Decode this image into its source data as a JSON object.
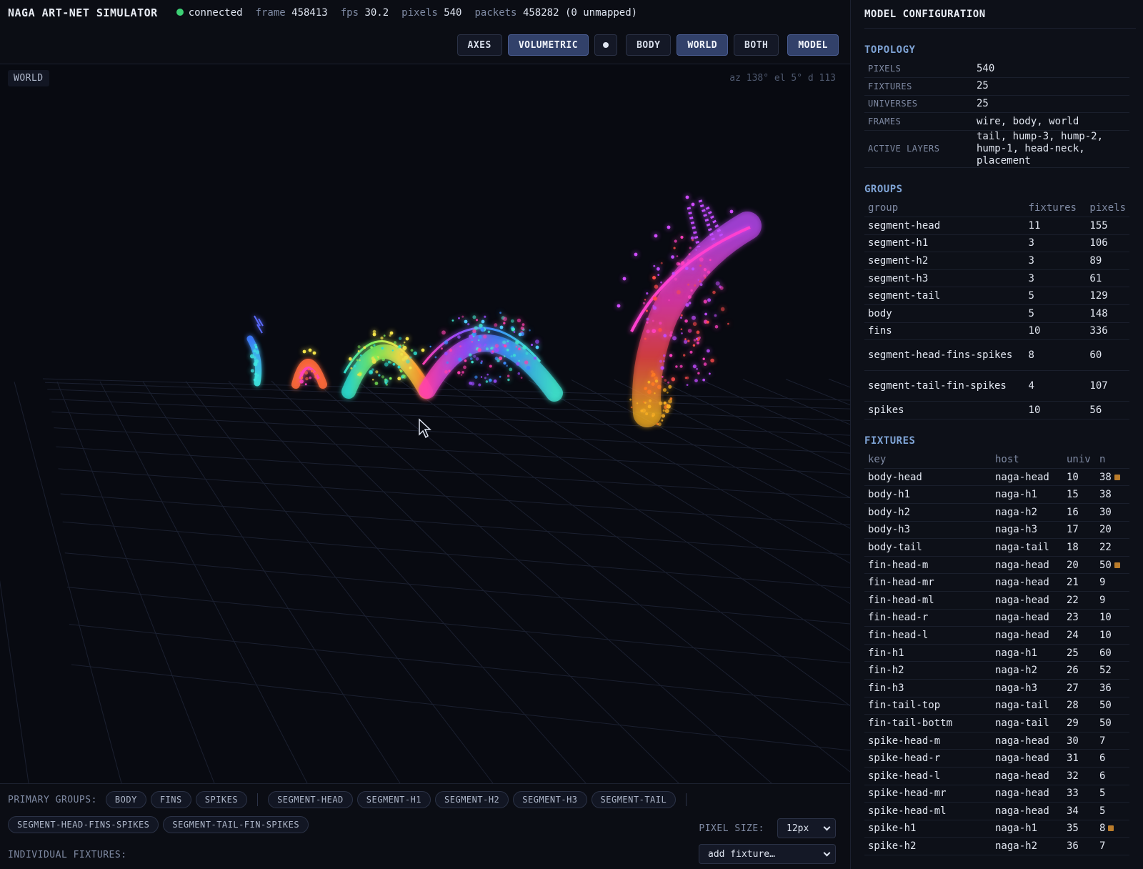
{
  "app": {
    "title": "NAGA ART-NET SIMULATOR",
    "status": "connected",
    "stats": [
      {
        "label": "frame",
        "value": "458413"
      },
      {
        "label": "fps",
        "value": "30.2"
      },
      {
        "label": "pixels",
        "value": "540"
      },
      {
        "label": "packets",
        "value": "458282 (0 unmapped)"
      }
    ]
  },
  "toolbar": {
    "axes": "AXES",
    "volumetric": "VOLUMETRIC",
    "body": "BODY",
    "world": "WORLD",
    "both": "BOTH",
    "model": "MODEL"
  },
  "viewport": {
    "label": "WORLD",
    "camera": "az 138° el 5° d 113"
  },
  "bottom": {
    "primary_label": "PRIMARY GROUPS:",
    "primary_groups": [
      "BODY",
      "FINS",
      "SPIKES"
    ],
    "segment_groups": [
      "SEGMENT-HEAD",
      "SEGMENT-H1",
      "SEGMENT-H2",
      "SEGMENT-H3",
      "SEGMENT-TAIL"
    ],
    "extra_groups": [
      "SEGMENT-HEAD-FINS-SPIKES",
      "SEGMENT-TAIL-FIN-SPIKES"
    ],
    "pixel_size_label": "PIXEL SIZE:",
    "pixel_size_value": "12px",
    "individual_label": "INDIVIDUAL FIXTURES:",
    "add_fixture": "add fixture…"
  },
  "panel": {
    "title": "MODEL CONFIGURATION",
    "topology": {
      "title": "TOPOLOGY",
      "rows": [
        {
          "k": "PIXELS",
          "v": "540"
        },
        {
          "k": "FIXTURES",
          "v": "25"
        },
        {
          "k": "UNIVERSES",
          "v": "25"
        },
        {
          "k": "FRAMES",
          "v": "wire, body, world"
        },
        {
          "k": "ACTIVE LAYERS",
          "v": "tail, hump-3, hump-2, hump-1, head-neck, placement"
        }
      ]
    },
    "groups": {
      "title": "GROUPS",
      "headers": [
        "group",
        "fixtures",
        "pixels"
      ],
      "rows": [
        [
          "segment-head",
          "11",
          "155"
        ],
        [
          "segment-h1",
          "3",
          "106"
        ],
        [
          "segment-h2",
          "3",
          "89"
        ],
        [
          "segment-h3",
          "3",
          "61"
        ],
        [
          "segment-tail",
          "5",
          "129"
        ],
        [
          "body",
          "5",
          "148"
        ],
        [
          "fins",
          "10",
          "336"
        ],
        [
          "segment-head-fins-spikes",
          "8",
          "60"
        ],
        [
          "segment-tail-fin-spikes",
          "4",
          "107"
        ],
        [
          "spikes",
          "10",
          "56"
        ]
      ]
    },
    "fixtures": {
      "title": "FIXTURES",
      "headers": [
        "key",
        "host",
        "univ",
        "n"
      ],
      "rows": [
        [
          "body-head",
          "naga-head",
          "10",
          "38",
          true
        ],
        [
          "body-h1",
          "naga-h1",
          "15",
          "38",
          false
        ],
        [
          "body-h2",
          "naga-h2",
          "16",
          "30",
          false
        ],
        [
          "body-h3",
          "naga-h3",
          "17",
          "20",
          false
        ],
        [
          "body-tail",
          "naga-tail",
          "18",
          "22",
          false
        ],
        [
          "fin-head-m",
          "naga-head",
          "20",
          "50",
          true
        ],
        [
          "fin-head-mr",
          "naga-head",
          "21",
          "9",
          false
        ],
        [
          "fin-head-ml",
          "naga-head",
          "22",
          "9",
          false
        ],
        [
          "fin-head-r",
          "naga-head",
          "23",
          "10",
          false
        ],
        [
          "fin-head-l",
          "naga-head",
          "24",
          "10",
          false
        ],
        [
          "fin-h1",
          "naga-h1",
          "25",
          "60",
          false
        ],
        [
          "fin-h2",
          "naga-h2",
          "26",
          "52",
          false
        ],
        [
          "fin-h3",
          "naga-h3",
          "27",
          "36",
          false
        ],
        [
          "fin-tail-top",
          "naga-tail",
          "28",
          "50",
          false
        ],
        [
          "fin-tail-bottm",
          "naga-tail",
          "29",
          "50",
          false
        ],
        [
          "spike-head-m",
          "naga-head",
          "30",
          "7",
          false
        ],
        [
          "spike-head-r",
          "naga-head",
          "31",
          "6",
          false
        ],
        [
          "spike-head-l",
          "naga-head",
          "32",
          "6",
          false
        ],
        [
          "spike-head-mr",
          "naga-head",
          "33",
          "5",
          false
        ],
        [
          "spike-head-ml",
          "naga-head",
          "34",
          "5",
          false
        ],
        [
          "spike-h1",
          "naga-h1",
          "35",
          "8",
          true
        ],
        [
          "spike-h2",
          "naga-h2",
          "36",
          "7",
          false
        ]
      ]
    }
  },
  "colors": {
    "connected": "#3ccf74",
    "accent": "#7fa4d6",
    "active_button": "#32416a"
  }
}
